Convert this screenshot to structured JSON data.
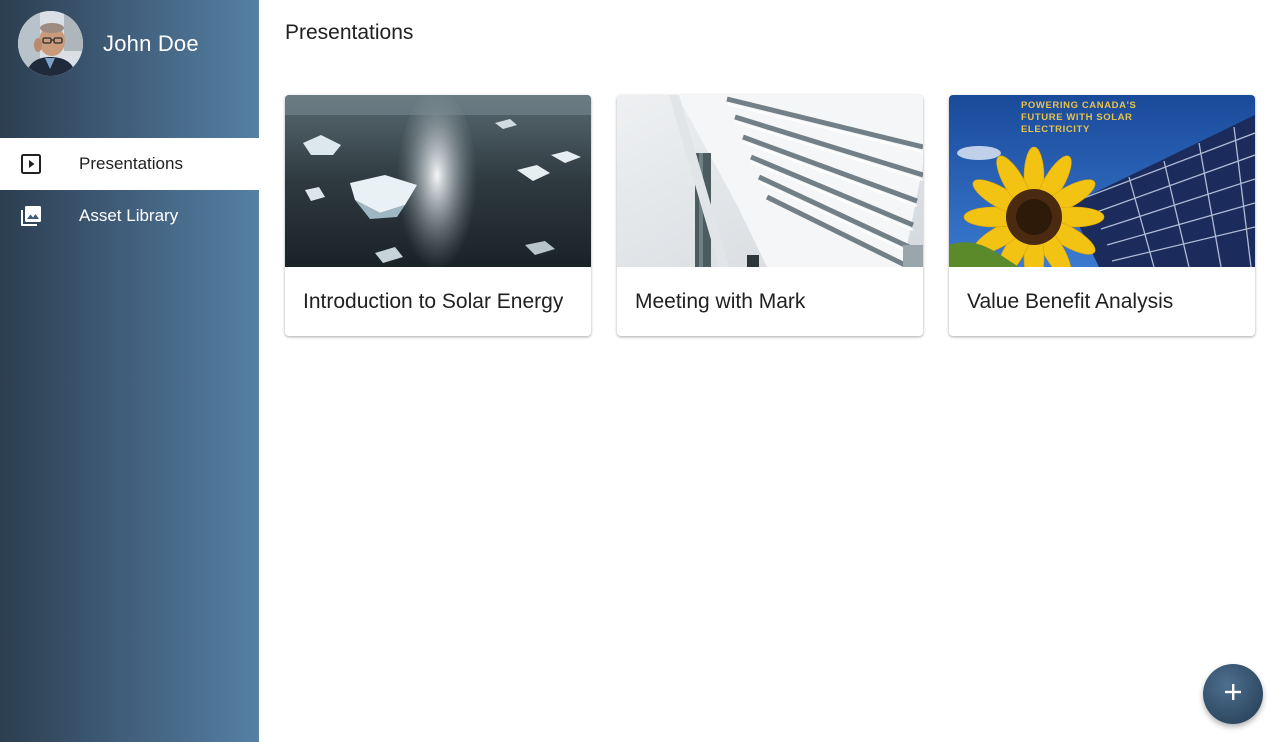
{
  "user": {
    "name": "John Doe"
  },
  "nav": {
    "items": [
      {
        "label": "Presentations",
        "icon": "slideshow-icon",
        "active": true
      },
      {
        "label": "Asset Library",
        "icon": "photo-library-icon",
        "active": false
      }
    ]
  },
  "main": {
    "title": "Presentations",
    "cards": [
      {
        "title": "Introduction to Solar Energy",
        "thumbnail": "arctic-ice-sea-thumbnail"
      },
      {
        "title": "Meeting with Mark",
        "thumbnail": "solar-panel-structure-thumbnail"
      },
      {
        "title": "Value Benefit Analysis",
        "thumbnail": "sunflower-solar-panels-thumbnail",
        "thumbnail_text": "POWERING CANADA'S FUTURE WITH SOLAR ELECTRICITY"
      }
    ]
  },
  "fab": {
    "icon": "plus-icon"
  },
  "colors": {
    "sidebar_dark": "#2c3e50",
    "sidebar_light": "#5580a4",
    "fab": "#2f4a63",
    "thumbnail_text": "#e8c24a"
  }
}
